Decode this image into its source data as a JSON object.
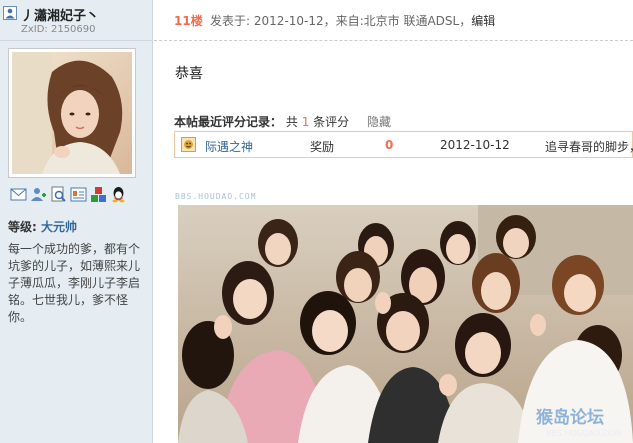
{
  "user": {
    "username": "丿瀟湘妃子丶",
    "zxid": "ZxID: 2150690",
    "level_label": "等级:",
    "level_value": "大元帅",
    "signature": "每一个成功的爹，都有个坑爹的儿子，如薄熙来儿子薄瓜瓜，李刚儿子李启铭。七世我儿，爹不怪你。"
  },
  "tools": [
    "message-icon",
    "add-friend-icon",
    "view-profile-icon",
    "user-card-icon",
    "blocks-icon",
    "qq-icon"
  ],
  "post": {
    "floor": "11楼",
    "meta": "发表于: 2012-10-12，来自:北京市 联通ADSL，",
    "edit_label": "编辑",
    "content": "恭喜"
  },
  "rating": {
    "title": "本帖最近评分记录：",
    "count_prefix": "共",
    "count": "1",
    "count_suffix": "条评分",
    "hide_label": "隐藏",
    "rows": [
      {
        "rater": "际遇之神",
        "type": "奖励",
        "score": "0",
        "date": "2012-10-12",
        "reason": "追寻春哥的脚步，"
      }
    ]
  },
  "image": {
    "watermark_top": "BBS.HOUDAO.COM",
    "watermark_logo": "猴岛论坛",
    "watermark_url": "BBS.HOUDAO.COM"
  },
  "colors": {
    "sidebar_bg": "#e5edf2",
    "accent": "#f26c4f",
    "link": "#336699"
  }
}
